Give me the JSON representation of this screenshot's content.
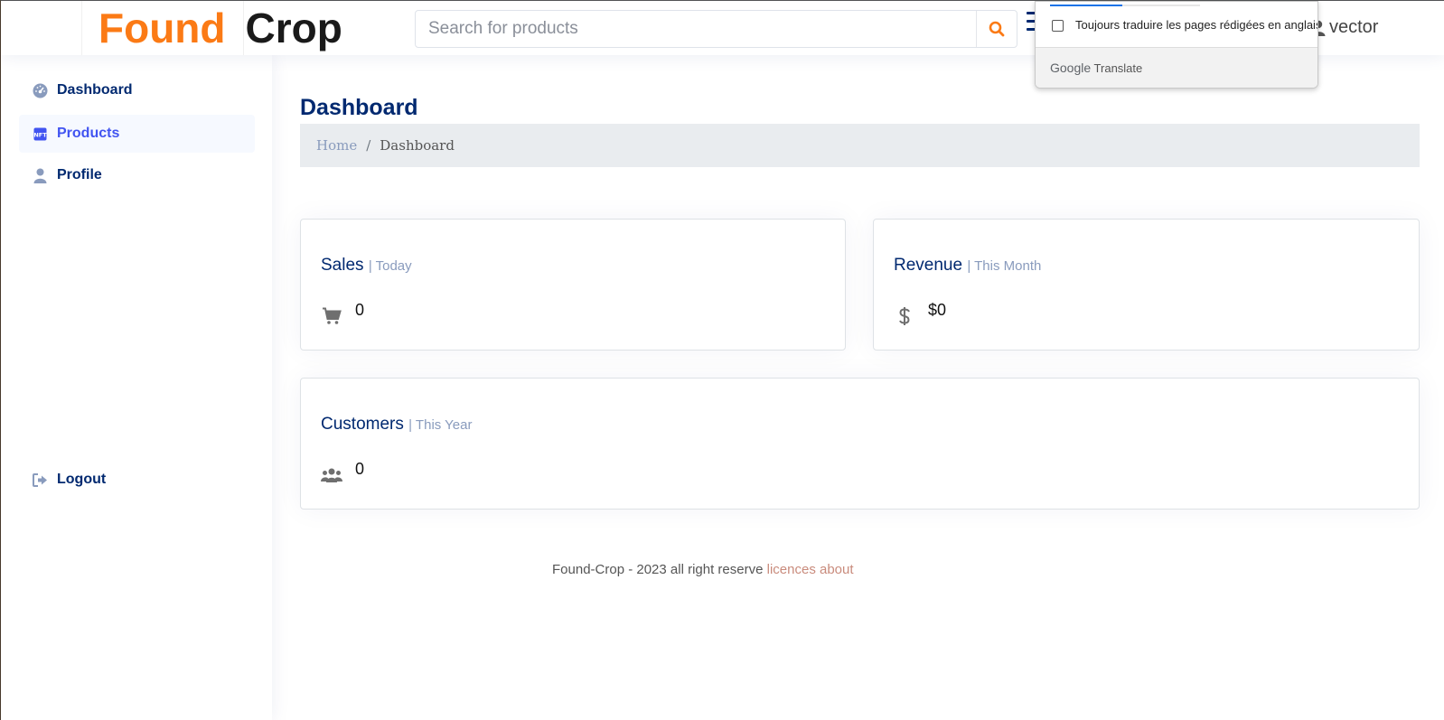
{
  "header": {
    "logo_part1": "Found",
    "logo_part2": "Crop",
    "search_placeholder": "Search for products",
    "user_name": "vector",
    "accent": "#fb7a15"
  },
  "translate_popup": {
    "checkbox_label": "Toujours traduire les pages rédigées en anglais",
    "brand_google": "Google",
    "brand_translate": "Translate"
  },
  "sidebar": {
    "items": [
      {
        "label": "Dashboard",
        "icon": "dashboard-icon"
      },
      {
        "label": "Products",
        "icon": "nft-icon"
      },
      {
        "label": "Profile",
        "icon": "person-icon"
      }
    ],
    "logout_label": "Logout"
  },
  "main": {
    "title": "Dashboard",
    "breadcrumb": {
      "home": "Home",
      "separator": "/",
      "current": "Dashboard"
    },
    "cards": {
      "sales": {
        "title": "Sales",
        "period": "| Today",
        "value": "0",
        "icon": "cart-icon"
      },
      "revenue": {
        "title": "Revenue",
        "period": "| This Month",
        "value": "$0",
        "icon": "dollar-icon"
      },
      "customers": {
        "title": "Customers",
        "period": "| This Year",
        "value": "0",
        "icon": "people-icon"
      }
    }
  },
  "footer": {
    "text": "Found-Crop - 2023 all right reserve",
    "links": "licences about"
  }
}
